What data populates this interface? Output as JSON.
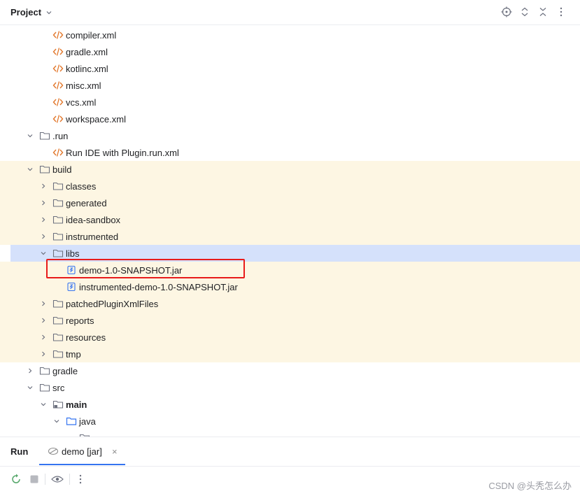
{
  "header": {
    "title": "Project"
  },
  "tree": [
    {
      "label": "compiler.xml",
      "icon": "xml-file-icon",
      "arrow": null
    },
    {
      "label": "gradle.xml",
      "icon": "xml-file-icon",
      "arrow": null
    },
    {
      "label": "kotlinc.xml",
      "icon": "xml-file-icon",
      "arrow": null
    },
    {
      "label": "misc.xml",
      "icon": "xml-file-icon",
      "arrow": null
    },
    {
      "label": "vcs.xml",
      "icon": "xml-file-icon",
      "arrow": null
    },
    {
      "label": "workspace.xml",
      "icon": "xml-file-icon",
      "arrow": null
    },
    {
      "label": ".run",
      "icon": "folder-icon",
      "arrow": "down"
    },
    {
      "label": "Run IDE with Plugin.run.xml",
      "icon": "xml-file-icon",
      "arrow": null
    },
    {
      "label": "build",
      "icon": "folder-icon",
      "arrow": "down"
    },
    {
      "label": "classes",
      "icon": "folder-icon",
      "arrow": "right"
    },
    {
      "label": "generated",
      "icon": "folder-icon",
      "arrow": "right"
    },
    {
      "label": "idea-sandbox",
      "icon": "folder-icon",
      "arrow": "right"
    },
    {
      "label": "instrumented",
      "icon": "folder-icon",
      "arrow": "right"
    },
    {
      "label": "libs",
      "icon": "folder-icon",
      "arrow": "down"
    },
    {
      "label": "demo-1.0-SNAPSHOT.jar",
      "icon": "jar-file-icon",
      "arrow": null
    },
    {
      "label": "instrumented-demo-1.0-SNAPSHOT.jar",
      "icon": "jar-file-icon",
      "arrow": null
    },
    {
      "label": "patchedPluginXmlFiles",
      "icon": "folder-icon",
      "arrow": "right"
    },
    {
      "label": "reports",
      "icon": "folder-icon",
      "arrow": "right"
    },
    {
      "label": "resources",
      "icon": "folder-icon",
      "arrow": "right"
    },
    {
      "label": "tmp",
      "icon": "folder-icon",
      "arrow": "right"
    },
    {
      "label": "gradle",
      "icon": "folder-icon",
      "arrow": "right"
    },
    {
      "label": "src",
      "icon": "folder-icon",
      "arrow": "down"
    },
    {
      "label": "main",
      "icon": "source-root-folder-icon",
      "arrow": "down"
    },
    {
      "label": "java",
      "icon": "java-source-folder-icon",
      "arrow": "down"
    },
    {
      "label": "",
      "icon": "folder-icon",
      "arrow": null
    }
  ],
  "run_panel": {
    "title": "Run",
    "tab_label": "demo [jar]",
    "tab_close": "×"
  },
  "watermark": "CSDN @头秃怎么办",
  "colors": {
    "xml_icon": "#e2772b",
    "folder_icon": "#6c707e",
    "jar_icon": "#3574f0",
    "highlight_row": "#fdf6e3",
    "selected_row": "#d5e1fb",
    "red_box": "#e81b1b",
    "tab_underline": "#3574f0"
  }
}
